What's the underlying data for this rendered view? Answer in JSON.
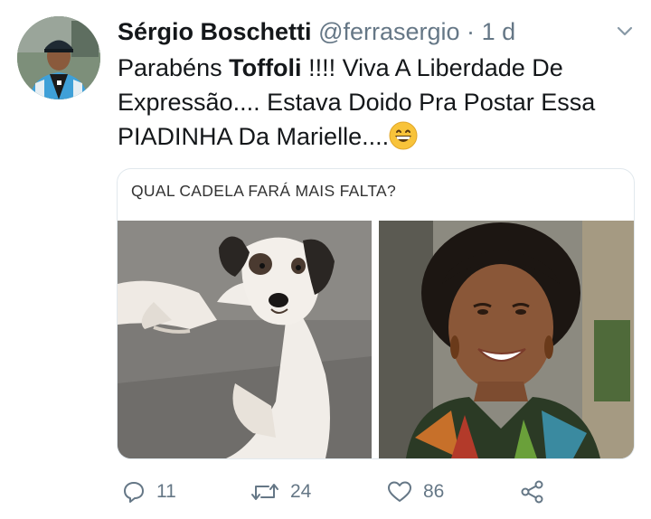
{
  "tweet": {
    "author_name": "Sérgio Boschetti",
    "handle": "@ferrasergio",
    "separator": "·",
    "time": "1 d",
    "text_before": "Parabéns ",
    "text_bold": "Toffoli",
    "text_after": " !!!!  Viva A Liberdade De Expressão.... Estava Doido Pra Postar Essa PIADINHA Da Marielle....",
    "emoji": "grinning-face-emoji"
  },
  "media": {
    "caption": "QUAL CADELA FARÁ MAIS FALTA?"
  },
  "actions": {
    "reply_count": "11",
    "retweet_count": "24",
    "like_count": "86",
    "reply_icon": "reply-icon",
    "retweet_icon": "retweet-icon",
    "like_icon": "heart-icon",
    "share_icon": "share-icon"
  },
  "colors": {
    "text": "#14171a",
    "secondary": "#657786",
    "border": "#e1e8ed"
  }
}
